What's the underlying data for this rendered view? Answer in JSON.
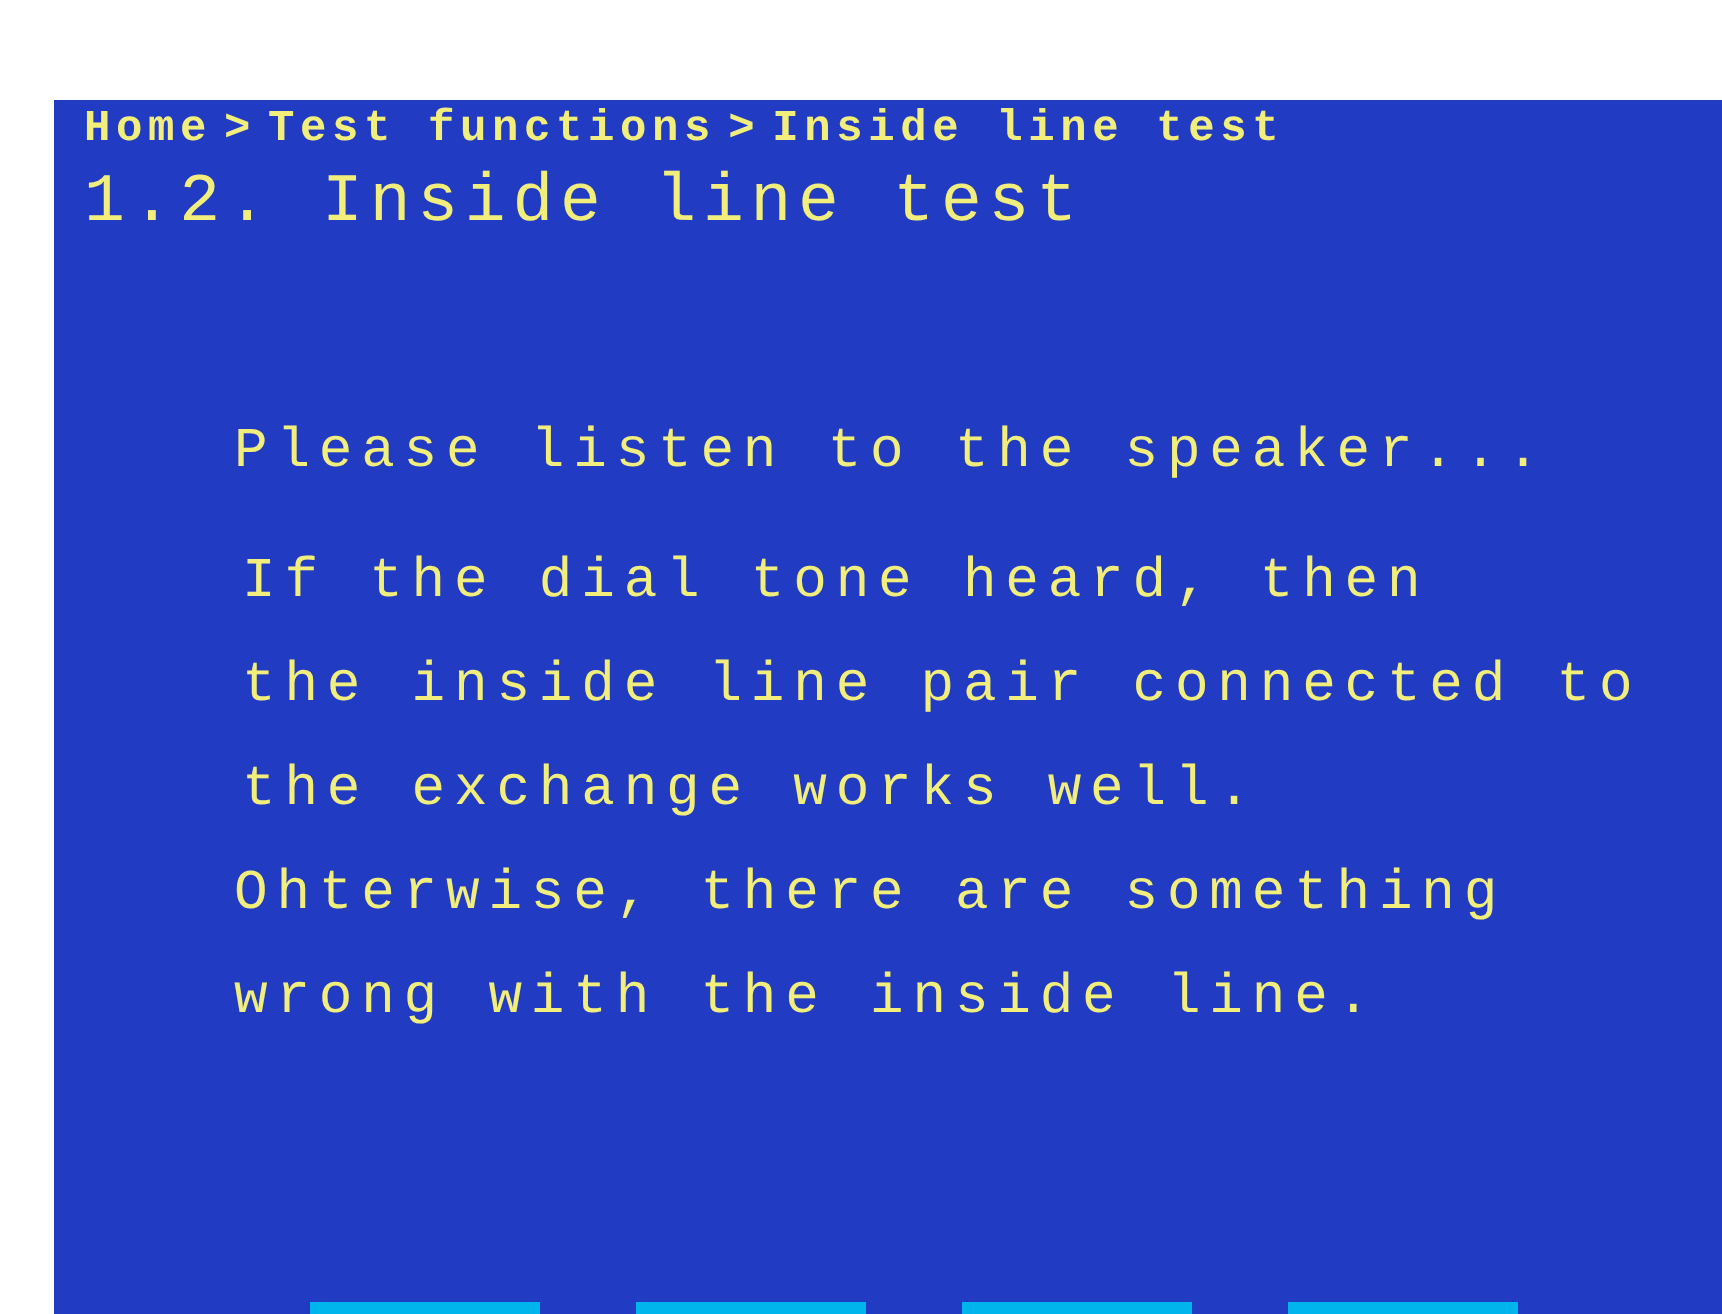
{
  "breadcrumb": {
    "items": [
      "Home",
      "Test functions",
      "Inside line test"
    ],
    "separator": ">"
  },
  "title": "1.2. Inside line test",
  "prompt": "Please listen to the speaker...",
  "message_lines": [
    "If the dial tone heard, then",
    "the inside line pair connected to",
    "the exchange works well.",
    "Ohterwise, there are something",
    "wrong with the inside line."
  ],
  "softkeys": [
    {
      "kind": "blank"
    },
    {
      "kind": "blank"
    },
    {
      "kind": "blank"
    },
    {
      "kind": "blank"
    }
  ]
}
